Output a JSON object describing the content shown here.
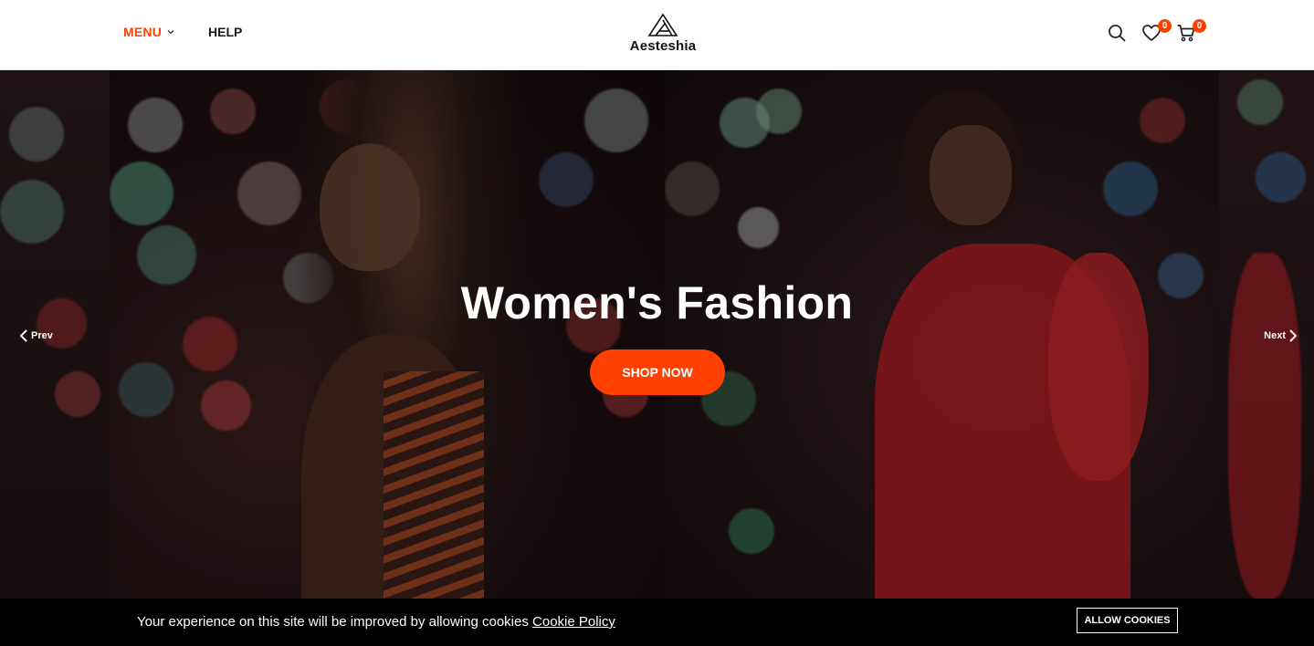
{
  "header": {
    "menu_label": "MENU",
    "help_label": "HELP",
    "logo_text": "Aesteshia",
    "wishlist_count": "0",
    "cart_count": "0"
  },
  "hero": {
    "title": "Women's Fashion",
    "cta_label": "SHOP NOW",
    "prev_label": "Prev",
    "next_label": "Next"
  },
  "cookie_bar": {
    "message": "Your experience on this site will be improved by allowing cookies",
    "policy_link": "Cookie Policy",
    "allow_label": "ALLOW COOKIES"
  },
  "colors": {
    "accent": "#ff4000",
    "header_bg": "#ffffff",
    "cookie_bg": "#000000"
  },
  "icons": [
    "chevron-down-icon",
    "search-icon",
    "heart-icon",
    "cart-icon",
    "chevron-left-icon",
    "chevron-right-icon",
    "logo-triangle-icon"
  ]
}
